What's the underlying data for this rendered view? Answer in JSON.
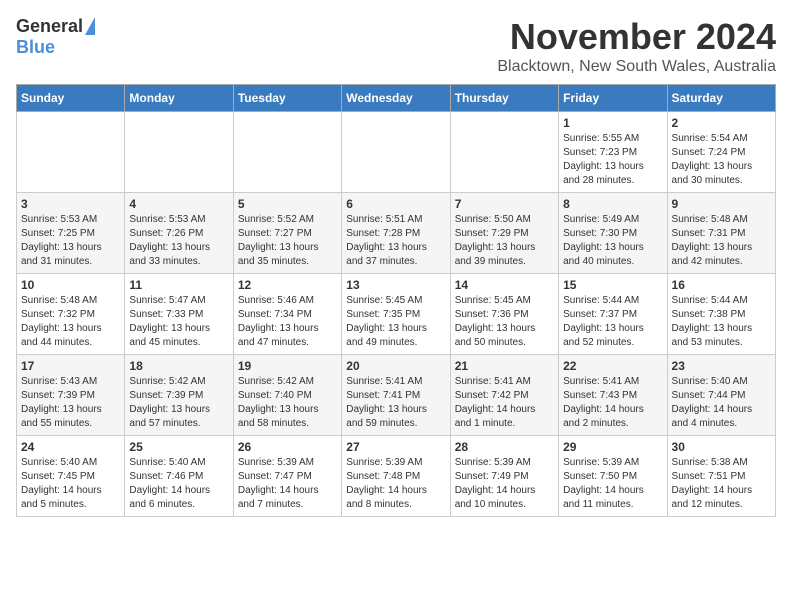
{
  "header": {
    "logo_general": "General",
    "logo_blue": "Blue",
    "month_title": "November 2024",
    "subtitle": "Blacktown, New South Wales, Australia"
  },
  "weekdays": [
    "Sunday",
    "Monday",
    "Tuesday",
    "Wednesday",
    "Thursday",
    "Friday",
    "Saturday"
  ],
  "weeks": [
    [
      {
        "day": "",
        "info": ""
      },
      {
        "day": "",
        "info": ""
      },
      {
        "day": "",
        "info": ""
      },
      {
        "day": "",
        "info": ""
      },
      {
        "day": "",
        "info": ""
      },
      {
        "day": "1",
        "info": "Sunrise: 5:55 AM\nSunset: 7:23 PM\nDaylight: 13 hours and 28 minutes."
      },
      {
        "day": "2",
        "info": "Sunrise: 5:54 AM\nSunset: 7:24 PM\nDaylight: 13 hours and 30 minutes."
      }
    ],
    [
      {
        "day": "3",
        "info": "Sunrise: 5:53 AM\nSunset: 7:25 PM\nDaylight: 13 hours and 31 minutes."
      },
      {
        "day": "4",
        "info": "Sunrise: 5:53 AM\nSunset: 7:26 PM\nDaylight: 13 hours and 33 minutes."
      },
      {
        "day": "5",
        "info": "Sunrise: 5:52 AM\nSunset: 7:27 PM\nDaylight: 13 hours and 35 minutes."
      },
      {
        "day": "6",
        "info": "Sunrise: 5:51 AM\nSunset: 7:28 PM\nDaylight: 13 hours and 37 minutes."
      },
      {
        "day": "7",
        "info": "Sunrise: 5:50 AM\nSunset: 7:29 PM\nDaylight: 13 hours and 39 minutes."
      },
      {
        "day": "8",
        "info": "Sunrise: 5:49 AM\nSunset: 7:30 PM\nDaylight: 13 hours and 40 minutes."
      },
      {
        "day": "9",
        "info": "Sunrise: 5:48 AM\nSunset: 7:31 PM\nDaylight: 13 hours and 42 minutes."
      }
    ],
    [
      {
        "day": "10",
        "info": "Sunrise: 5:48 AM\nSunset: 7:32 PM\nDaylight: 13 hours and 44 minutes."
      },
      {
        "day": "11",
        "info": "Sunrise: 5:47 AM\nSunset: 7:33 PM\nDaylight: 13 hours and 45 minutes."
      },
      {
        "day": "12",
        "info": "Sunrise: 5:46 AM\nSunset: 7:34 PM\nDaylight: 13 hours and 47 minutes."
      },
      {
        "day": "13",
        "info": "Sunrise: 5:45 AM\nSunset: 7:35 PM\nDaylight: 13 hours and 49 minutes."
      },
      {
        "day": "14",
        "info": "Sunrise: 5:45 AM\nSunset: 7:36 PM\nDaylight: 13 hours and 50 minutes."
      },
      {
        "day": "15",
        "info": "Sunrise: 5:44 AM\nSunset: 7:37 PM\nDaylight: 13 hours and 52 minutes."
      },
      {
        "day": "16",
        "info": "Sunrise: 5:44 AM\nSunset: 7:38 PM\nDaylight: 13 hours and 53 minutes."
      }
    ],
    [
      {
        "day": "17",
        "info": "Sunrise: 5:43 AM\nSunset: 7:39 PM\nDaylight: 13 hours and 55 minutes."
      },
      {
        "day": "18",
        "info": "Sunrise: 5:42 AM\nSunset: 7:39 PM\nDaylight: 13 hours and 57 minutes."
      },
      {
        "day": "19",
        "info": "Sunrise: 5:42 AM\nSunset: 7:40 PM\nDaylight: 13 hours and 58 minutes."
      },
      {
        "day": "20",
        "info": "Sunrise: 5:41 AM\nSunset: 7:41 PM\nDaylight: 13 hours and 59 minutes."
      },
      {
        "day": "21",
        "info": "Sunrise: 5:41 AM\nSunset: 7:42 PM\nDaylight: 14 hours and 1 minute."
      },
      {
        "day": "22",
        "info": "Sunrise: 5:41 AM\nSunset: 7:43 PM\nDaylight: 14 hours and 2 minutes."
      },
      {
        "day": "23",
        "info": "Sunrise: 5:40 AM\nSunset: 7:44 PM\nDaylight: 14 hours and 4 minutes."
      }
    ],
    [
      {
        "day": "24",
        "info": "Sunrise: 5:40 AM\nSunset: 7:45 PM\nDaylight: 14 hours and 5 minutes."
      },
      {
        "day": "25",
        "info": "Sunrise: 5:40 AM\nSunset: 7:46 PM\nDaylight: 14 hours and 6 minutes."
      },
      {
        "day": "26",
        "info": "Sunrise: 5:39 AM\nSunset: 7:47 PM\nDaylight: 14 hours and 7 minutes."
      },
      {
        "day": "27",
        "info": "Sunrise: 5:39 AM\nSunset: 7:48 PM\nDaylight: 14 hours and 8 minutes."
      },
      {
        "day": "28",
        "info": "Sunrise: 5:39 AM\nSunset: 7:49 PM\nDaylight: 14 hours and 10 minutes."
      },
      {
        "day": "29",
        "info": "Sunrise: 5:39 AM\nSunset: 7:50 PM\nDaylight: 14 hours and 11 minutes."
      },
      {
        "day": "30",
        "info": "Sunrise: 5:38 AM\nSunset: 7:51 PM\nDaylight: 14 hours and 12 minutes."
      }
    ]
  ]
}
